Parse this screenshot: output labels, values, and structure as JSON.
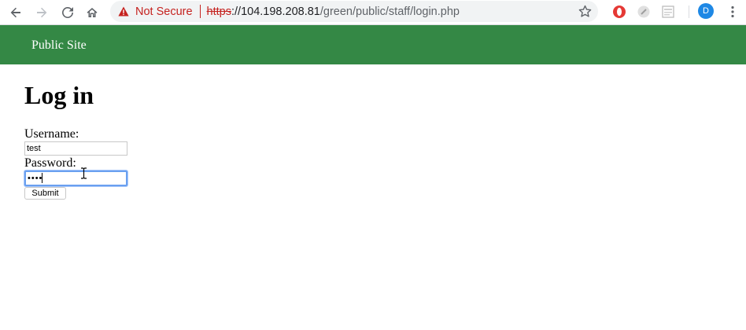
{
  "browser": {
    "security_label": "Not Secure",
    "url_scheme": "https",
    "url_rest_host": "://104.198.208.81",
    "url_path": "/green/public/staff/login.php",
    "profile_initial": "D",
    "icons": {
      "back": "back-arrow-icon",
      "forward": "forward-arrow-icon",
      "reload": "reload-icon",
      "home": "home-icon",
      "warning": "warning-icon",
      "bookmark": "star-icon",
      "menu": "kebab-menu-icon"
    },
    "colors": {
      "insecure": "#c5221f",
      "avatar": "#1e88e5"
    }
  },
  "site": {
    "header_link": "Public Site",
    "header_color": "#348845"
  },
  "login": {
    "title": "Log in",
    "username_label": "Username:",
    "username_value": "test",
    "password_label": "Password:",
    "password_value": "test",
    "submit_label": "Submit"
  }
}
